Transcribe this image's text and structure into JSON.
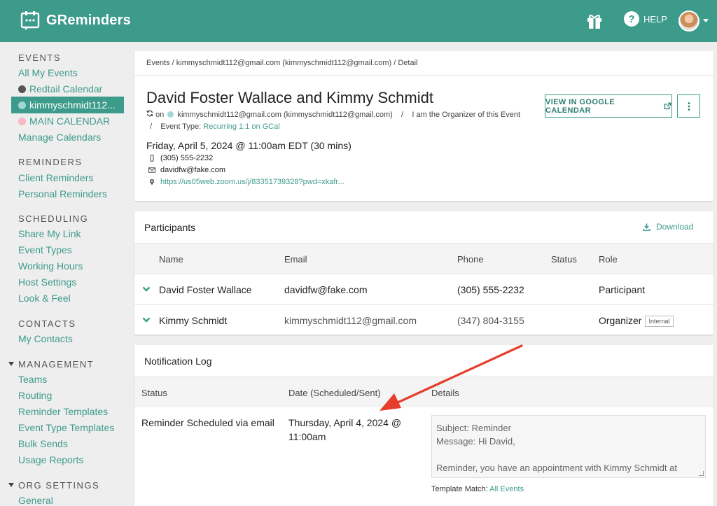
{
  "app": {
    "name": "GReminders",
    "help_label": "HELP"
  },
  "colors": {
    "brand": "#3d9b8c",
    "arrow": "#e53e2b",
    "redtail_dot": "#555555",
    "kimmy_dot": "#9fd8d6",
    "main_dot": "#f7b9c3"
  },
  "sidebar": {
    "events": {
      "heading": "EVENTS",
      "all_events": "All My Events",
      "redtail": "Redtail Calendar",
      "kimmy": "kimmyschmidt112...",
      "main": "MAIN CALENDAR",
      "manage": "Manage Calendars"
    },
    "reminders": {
      "heading": "REMINDERS",
      "client": "Client Reminders",
      "personal": "Personal Reminders"
    },
    "scheduling": {
      "heading": "SCHEDULING",
      "share": "Share My Link",
      "event_types": "Event Types",
      "working_hours": "Working Hours",
      "host_settings": "Host Settings",
      "look_feel": "Look & Feel"
    },
    "contacts": {
      "heading": "CONTACTS",
      "my_contacts": "My Contacts"
    },
    "management": {
      "heading": "MANAGEMENT",
      "teams": "Teams",
      "routing": "Routing",
      "reminder_templates": "Reminder Templates",
      "event_type_templates": "Event Type Templates",
      "bulk_sends": "Bulk Sends",
      "usage_reports": "Usage Reports"
    },
    "org_settings": {
      "heading": "ORG SETTINGS",
      "general": "General"
    }
  },
  "event": {
    "breadcrumb": "Events / kimmyschmidt112@gmail.com (kimmyschmidt112@gmail.com) / Detail",
    "title": "David Foster Wallace and Kimmy Schmidt",
    "meta_on": "on",
    "meta_calendar": "kimmyschmidt112@gmail.com (kimmyschmidt112@gmail.com)",
    "meta_sep1": "/",
    "meta_organizer": "I am the Organizer of this Event",
    "meta_sep2": "/",
    "meta_type_label": "Event Type:",
    "meta_type_value": "Recurring 1:1 on GCal",
    "datetime": "Friday, April 5, 2024 @ 11:00am EDT (30 mins)",
    "phone": "(305) 555-2232",
    "email": "davidfw@fake.com",
    "location": "https://us05web.zoom.us/j/83351739328?pwd=xkafr...",
    "btn_gcal": "VIEW IN GOOGLE CALENDAR"
  },
  "participants": {
    "title": "Participants",
    "download": "Download",
    "headers": {
      "name": "Name",
      "email": "Email",
      "phone": "Phone",
      "status": "Status",
      "role": "Role"
    },
    "rows": [
      {
        "name": "David Foster Wallace",
        "email": "davidfw@fake.com",
        "phone": "(305) 555-2232",
        "status": "",
        "role": "Participant",
        "badge": ""
      },
      {
        "name": "Kimmy Schmidt",
        "email": "kimmyschmidt112@gmail.com",
        "phone": "(347) 804-3155",
        "status": "",
        "role": "Organizer",
        "badge": "Internal"
      }
    ]
  },
  "notification_log": {
    "title": "Notification Log",
    "headers": {
      "status": "Status",
      "date": "Date (Scheduled/Sent)",
      "details": "Details"
    },
    "row": {
      "status": "Reminder Scheduled via email",
      "date": "Thursday, April 4, 2024 @ 11:00am",
      "subject": "Subject: Reminder",
      "message": "Message: Hi David,",
      "body": "Reminder, you have an appointment with Kimmy Schmidt at",
      "template_label": "Template Match:",
      "template_value": "All Events"
    }
  }
}
